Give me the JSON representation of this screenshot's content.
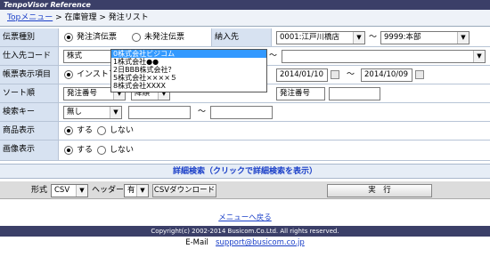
{
  "app_title": "TenpoVisor Reference",
  "breadcrumb": {
    "top": "Topメニュー",
    "sep1": " > ",
    "mid": "在庫管理",
    "sep2": " > ",
    "current": "発注リスト"
  },
  "rows": {
    "slip_type": {
      "label": "伝票種別",
      "opt1": "発注済伝票",
      "opt2": "未発注伝票",
      "selected": "発注済伝票"
    },
    "delivery": {
      "label": "納入先",
      "from": "0001:江戸川橋店",
      "to": "9999:本部",
      "tilde": "～"
    },
    "supplier_code": {
      "label": "仕入先コード",
      "value": "株式",
      "tilde": "～"
    },
    "report_item": {
      "label": "帳票表示項目",
      "opt1": "インストア",
      "date_from": "2014/01/10",
      "date_to": "2014/10/09",
      "tilde": "～"
    },
    "sort": {
      "label": "ソート順",
      "value1": "発注番号",
      "value2": "降順",
      "label2": "発注番号"
    },
    "search_key": {
      "label": "検索キー",
      "value": "無し",
      "tilde": "～"
    },
    "product_display": {
      "label": "商品表示",
      "opt1": "する",
      "opt2": "しない"
    },
    "image_display": {
      "label": "画像表示",
      "opt1": "する",
      "opt2": "しない"
    }
  },
  "supplier_dropdown": [
    "0株式会社ビジコム",
    "1株式会社●●",
    "2日BBB株式会社？",
    "5株式会社××××５",
    "8株式会社XXXX"
  ],
  "detail_search": "詳細検索（クリックで詳細検索を表示）",
  "footer_bar": {
    "format_label": "形式",
    "format_value": "CSV",
    "header_label": "ヘッダー",
    "header_value": "有",
    "csv_download": "CSVダウンロード",
    "execute": "実　行"
  },
  "menu_back": "メニューへ戻る",
  "copyright": "Copyright(c) 2002-2014 Busicom.Co.Ltd. All rights reserved.",
  "email_label": "E-Mail",
  "email": "support@busicom.co.jp"
}
